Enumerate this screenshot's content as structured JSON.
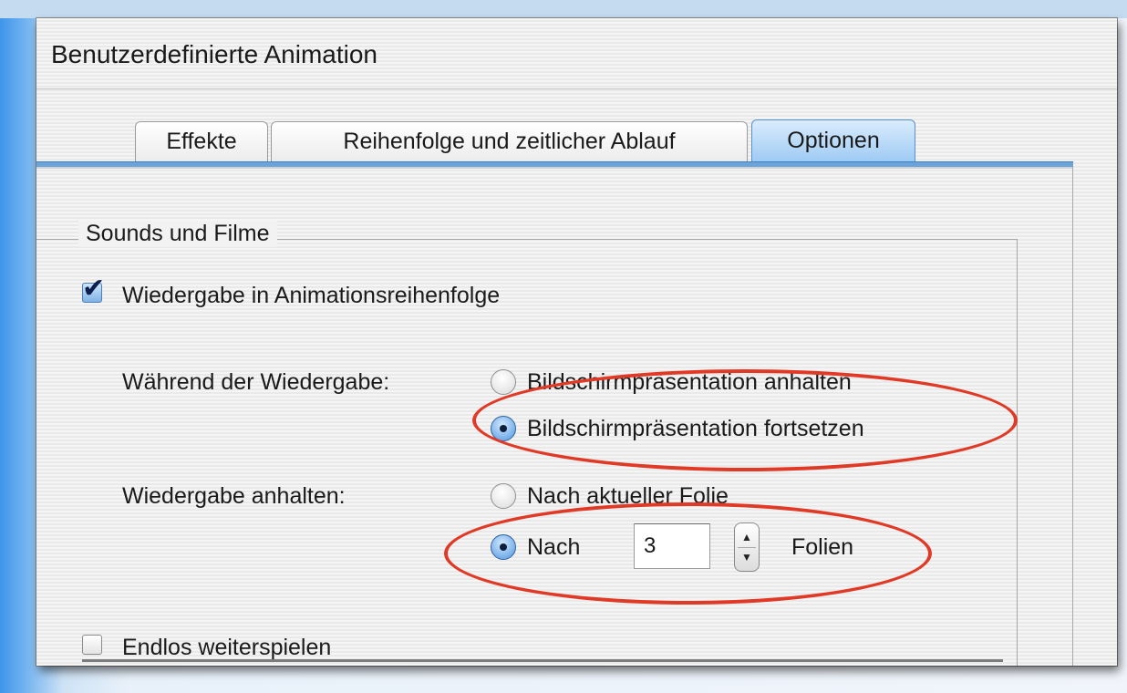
{
  "window": {
    "title": "Benutzerdefinierte Animation"
  },
  "tabs": [
    {
      "label": "Effekte",
      "active": false
    },
    {
      "label": "Reihenfolge und zeitlicher Ablauf",
      "active": false
    },
    {
      "label": "Optionen",
      "active": true
    }
  ],
  "sounds_group": {
    "legend": "Sounds und Filme",
    "play_in_order": {
      "label": "Wiedergabe in Animationsreihenfolge",
      "checked": true
    },
    "during_playback": {
      "label": "Während der Wiedergabe:",
      "options": [
        {
          "label": "Bildschirmpräsentation anhalten",
          "selected": false
        },
        {
          "label": "Bildschirmpräsentation fortsetzen",
          "selected": true
        }
      ]
    },
    "stop_playback": {
      "label": "Wiedergabe anhalten:",
      "after_current": {
        "label": "Nach aktueller Folie",
        "selected": false
      },
      "after_n": {
        "prefix": "Nach",
        "value": "3",
        "suffix": "Folien",
        "selected": true
      }
    },
    "loop": {
      "label": "Endlos weiterspielen",
      "checked": false
    }
  },
  "colors": {
    "annotation": "#e03a27",
    "active_tab": "#9fcbf3",
    "accent_line": "#6aa4db"
  }
}
